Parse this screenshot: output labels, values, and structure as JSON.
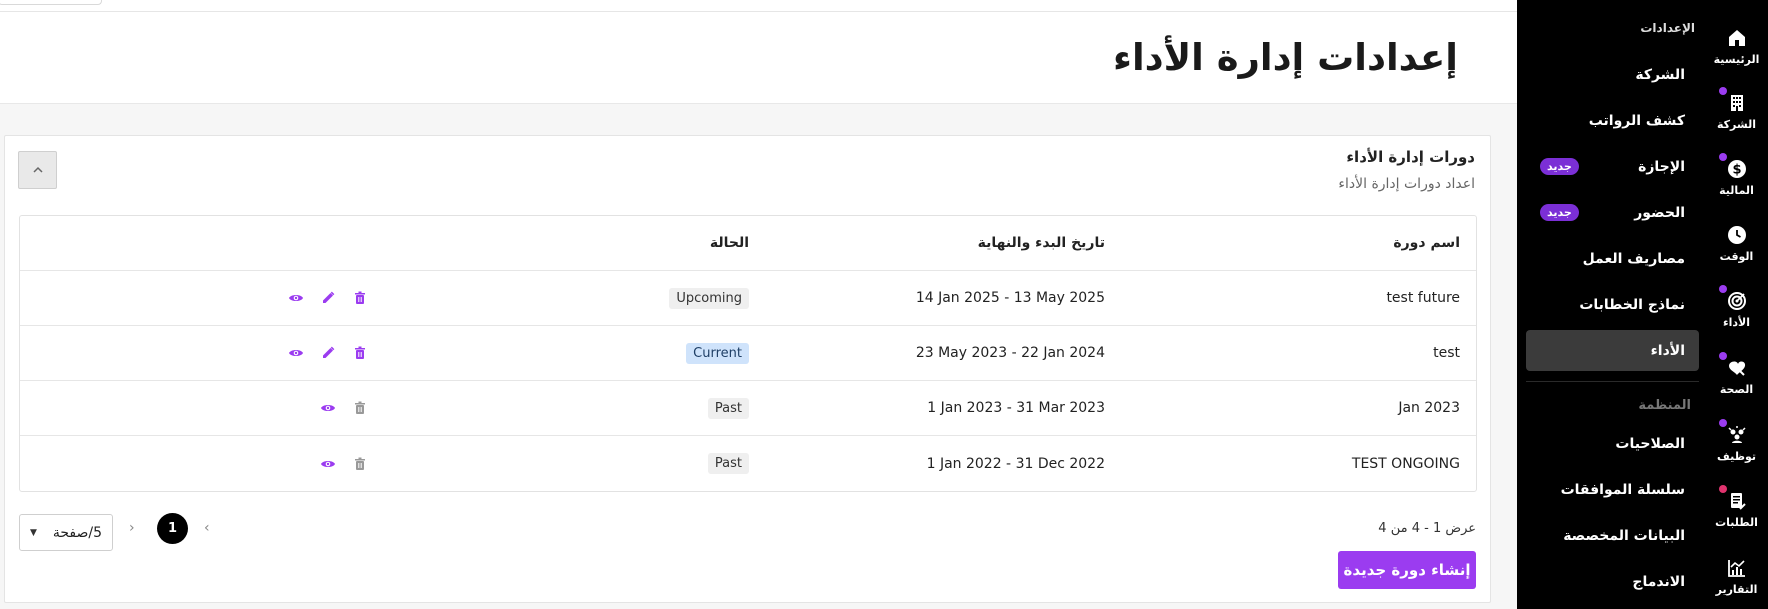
{
  "header": {
    "title": "إعدادات إدارة الأداء"
  },
  "card": {
    "title": "دورات إدارة الأداء",
    "subtitle": "اعداد دورات إدارة الأداء",
    "collapse_icon": "chevron-up-icon"
  },
  "table": {
    "columns": [
      "اسم دورة",
      "تاريخ البدء والنهاية",
      "الحالة"
    ],
    "rows": [
      {
        "name": "test future",
        "dates": "14 Jan 2025 - 13 May 2025",
        "status": "Upcoming",
        "actions": [
          "delete",
          "edit",
          "view"
        ]
      },
      {
        "name": "test",
        "dates": "23 May 2023 - 22 Jan 2024",
        "status": "Current",
        "actions": [
          "delete",
          "edit",
          "view"
        ]
      },
      {
        "name": "Jan 2023",
        "dates": "1 Jan 2023 - 31 Mar 2023",
        "status": "Past",
        "actions": [
          "delete",
          "view"
        ]
      },
      {
        "name": "TEST ONGOING",
        "dates": "1 Jan 2022 - 31 Dec 2022",
        "status": "Past",
        "actions": [
          "delete",
          "view"
        ]
      }
    ]
  },
  "pagination": {
    "info": "عرض 1 - 4 من 4",
    "current_page": "1",
    "page_size": "5/صفحة"
  },
  "create_button": "إنشاء دورة جديدة",
  "submenu": {
    "section_title": "الإعدادات",
    "items": [
      {
        "label": "الشركة",
        "badge": ""
      },
      {
        "label": "كشف الرواتب",
        "badge": ""
      },
      {
        "label": "الإجازة",
        "badge": "جديد"
      },
      {
        "label": "الحضور",
        "badge": "جديد"
      },
      {
        "label": "مصاريف العمل",
        "badge": ""
      },
      {
        "label": "نماذج الخطابات",
        "badge": ""
      },
      {
        "label": "الأداء",
        "badge": "",
        "active": true
      }
    ],
    "org_section": "المنظمة",
    "org_items": [
      {
        "label": "الصلاحيات"
      },
      {
        "label": "سلسلة الموافقات"
      },
      {
        "label": "البيانات المخصصة"
      },
      {
        "label": "الاندماج"
      }
    ]
  },
  "rail": [
    {
      "label": "الرئيسية",
      "icon": "home-icon"
    },
    {
      "label": "الشركة",
      "icon": "building-icon"
    },
    {
      "label": "المالية",
      "icon": "dollar-icon"
    },
    {
      "label": "الوقت",
      "icon": "clock-icon"
    },
    {
      "label": "الأداء",
      "icon": "target-icon"
    },
    {
      "label": "الصحة",
      "icon": "health-icon"
    },
    {
      "label": "توظيف",
      "icon": "recruit-icon"
    },
    {
      "label": "الطلبات",
      "icon": "requests-icon"
    },
    {
      "label": "التقارير",
      "icon": "reports-icon"
    }
  ],
  "colors": {
    "accent": "#9b3cf0",
    "badge": "#7b2fd6",
    "sidebar": "#000000",
    "current_badge": "#cfe3fb"
  }
}
